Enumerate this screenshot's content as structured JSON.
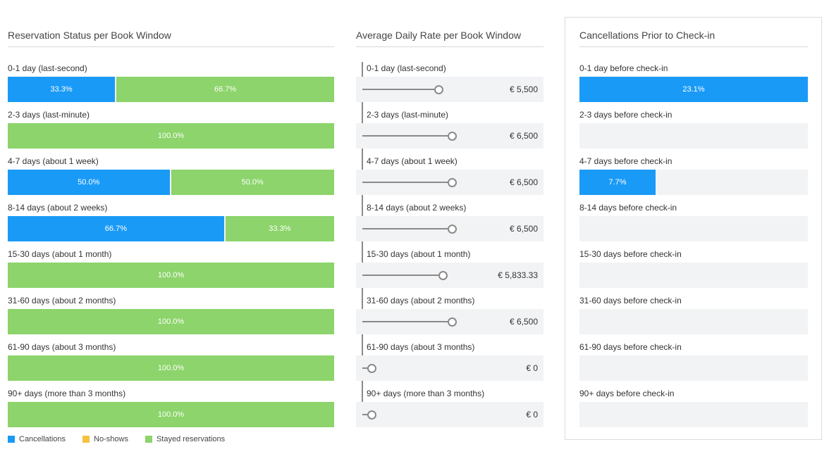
{
  "status_panel": {
    "title": "Reservation Status per Book Window",
    "rows": [
      {
        "label": "0-1 day (last-second)",
        "cancel": 33.3,
        "noshow": 0,
        "stayed": 66.7,
        "cancel_text": "33.3%",
        "stayed_text": "66.7%"
      },
      {
        "label": "2-3 days (last-minute)",
        "cancel": 0,
        "noshow": 0,
        "stayed": 100,
        "cancel_text": "",
        "stayed_text": "100.0%"
      },
      {
        "label": "4-7 days (about 1 week)",
        "cancel": 50,
        "noshow": 0,
        "stayed": 50,
        "cancel_text": "50.0%",
        "stayed_text": "50.0%"
      },
      {
        "label": "8-14 days (about 2 weeks)",
        "cancel": 66.7,
        "noshow": 0,
        "stayed": 33.3,
        "cancel_text": "66.7%",
        "stayed_text": "33.3%"
      },
      {
        "label": "15-30 days (about 1 month)",
        "cancel": 0,
        "noshow": 0,
        "stayed": 100,
        "cancel_text": "",
        "stayed_text": "100.0%"
      },
      {
        "label": "31-60 days (about 2 months)",
        "cancel": 0,
        "noshow": 0,
        "stayed": 100,
        "cancel_text": "",
        "stayed_text": "100.0%"
      },
      {
        "label": "61-90 days (about 3 months)",
        "cancel": 0,
        "noshow": 0,
        "stayed": 100,
        "cancel_text": "",
        "stayed_text": "100.0%"
      },
      {
        "label": "90+ days (more than 3 months)",
        "cancel": 0,
        "noshow": 0,
        "stayed": 100,
        "cancel_text": "",
        "stayed_text": "100.0%"
      }
    ]
  },
  "rate_panel": {
    "title": "Average Daily Rate per Book Window",
    "max_value": 6500,
    "rows": [
      {
        "label": "0-1 day (last-second)",
        "value": 5500,
        "value_text": "€ 5,500"
      },
      {
        "label": "2-3 days (last-minute)",
        "value": 6500,
        "value_text": "€ 6,500"
      },
      {
        "label": "4-7 days (about 1 week)",
        "value": 6500,
        "value_text": "€ 6,500"
      },
      {
        "label": "8-14 days (about 2 weeks)",
        "value": 6500,
        "value_text": "€ 6,500"
      },
      {
        "label": "15-30 days (about 1 month)",
        "value": 5833.33,
        "value_text": "€ 5,833.33"
      },
      {
        "label": "31-60 days (about 2 months)",
        "value": 6500,
        "value_text": "€ 6,500"
      },
      {
        "label": "61-90 days (about 3 months)",
        "value": 0,
        "value_text": "€ 0"
      },
      {
        "label": "90+ days (more than 3 months)",
        "value": 0,
        "value_text": "€ 0"
      }
    ]
  },
  "cancel_panel": {
    "title": "Cancellations Prior to Check-in",
    "rows": [
      {
        "label": "0-1 day before check-in",
        "value": 23.1,
        "value_text": "23.1%"
      },
      {
        "label": "2-3 days before check-in",
        "value": 0,
        "value_text": ""
      },
      {
        "label": "4-7 days before check-in",
        "value": 7.7,
        "value_text": "7.7%"
      },
      {
        "label": "8-14 days before check-in",
        "value": 0,
        "value_text": ""
      },
      {
        "label": "15-30 days before check-in",
        "value": 0,
        "value_text": ""
      },
      {
        "label": "31-60 days before check-in",
        "value": 0,
        "value_text": ""
      },
      {
        "label": "61-90 days before check-in",
        "value": 0,
        "value_text": ""
      },
      {
        "label": "90+ days before check-in",
        "value": 0,
        "value_text": ""
      }
    ]
  },
  "legend": [
    {
      "label": "Cancellations",
      "color": "#1a9af7"
    },
    {
      "label": "No-shows",
      "color": "#f5c242"
    },
    {
      "label": "Stayed reservations",
      "color": "#8cd46b"
    }
  ],
  "chart_data": [
    {
      "type": "bar",
      "title": "Reservation Status per Book Window",
      "categories": [
        "0-1 day (last-second)",
        "2-3 days (last-minute)",
        "4-7 days (about 1 week)",
        "8-14 days (about 2 weeks)",
        "15-30 days (about 1 month)",
        "31-60 days (about 2 months)",
        "61-90 days (about 3 months)",
        "90+ days (more than 3 months)"
      ],
      "series": [
        {
          "name": "Cancellations",
          "values": [
            33.3,
            0,
            50.0,
            66.7,
            0,
            0,
            0,
            0
          ]
        },
        {
          "name": "No-shows",
          "values": [
            0,
            0,
            0,
            0,
            0,
            0,
            0,
            0
          ]
        },
        {
          "name": "Stayed reservations",
          "values": [
            66.7,
            100.0,
            50.0,
            33.3,
            100.0,
            100.0,
            100.0,
            100.0
          ]
        }
      ],
      "stacked": true,
      "orientation": "horizontal"
    },
    {
      "type": "bar",
      "title": "Average Daily Rate per Book Window",
      "categories": [
        "0-1 day (last-second)",
        "2-3 days (last-minute)",
        "4-7 days (about 1 week)",
        "8-14 days (about 2 weeks)",
        "15-30 days (about 1 month)",
        "31-60 days (about 2 months)",
        "61-90 days (about 3 months)",
        "90+ days (more than 3 months)"
      ],
      "values": [
        5500,
        6500,
        6500,
        6500,
        5833.33,
        6500,
        0,
        0
      ],
      "orientation": "horizontal",
      "style": "lollipop"
    },
    {
      "type": "bar",
      "title": "Cancellations Prior to Check-in",
      "categories": [
        "0-1 day before check-in",
        "2-3 days before check-in",
        "4-7 days before check-in",
        "8-14 days before check-in",
        "15-30 days before check-in",
        "31-60 days before check-in",
        "61-90 days before check-in",
        "90+ days before check-in"
      ],
      "values": [
        23.1,
        0,
        7.7,
        0,
        0,
        0,
        0,
        0
      ],
      "orientation": "horizontal"
    }
  ]
}
